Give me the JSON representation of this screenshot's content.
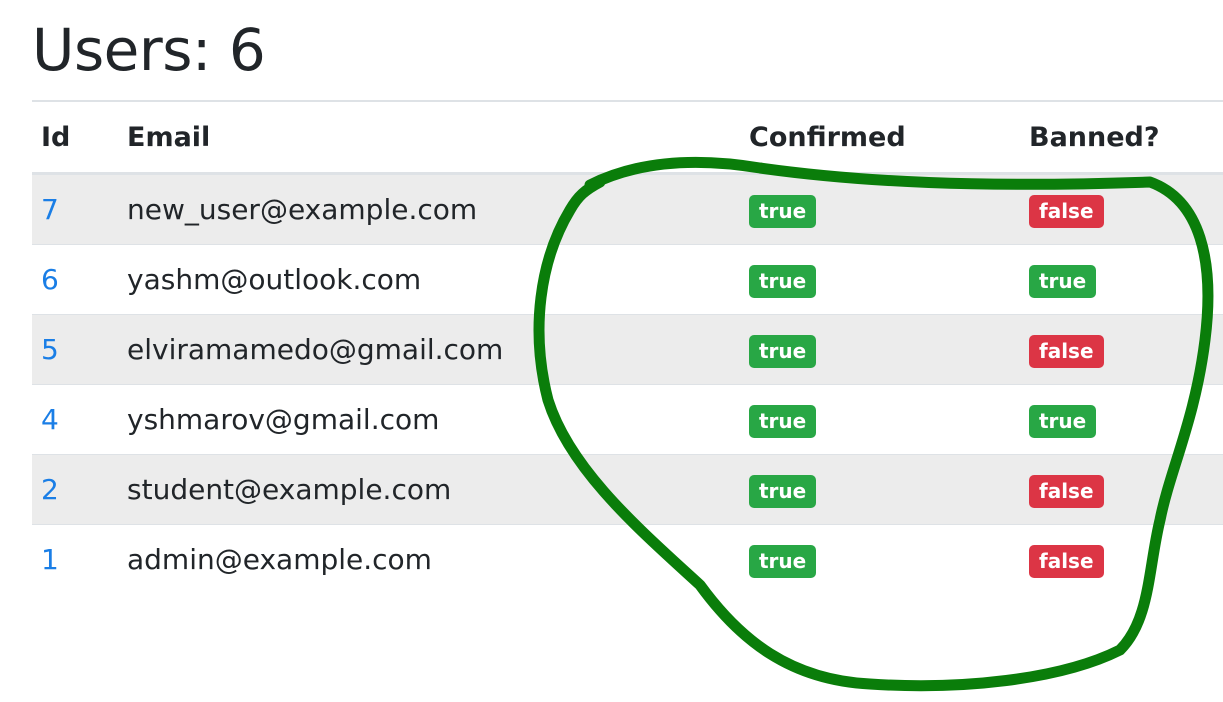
{
  "page": {
    "title": "Users: 6"
  },
  "table": {
    "headers": {
      "id": "Id",
      "email": "Email",
      "confirmed": "Confirmed",
      "banned": "Banned?"
    },
    "rows": [
      {
        "id": "7",
        "email": "new_user@example.com",
        "confirmed": "true",
        "banned": "false"
      },
      {
        "id": "6",
        "email": "yashm@outlook.com",
        "confirmed": "true",
        "banned": "true"
      },
      {
        "id": "5",
        "email": "elviramamedo@gmail.com",
        "confirmed": "true",
        "banned": "false"
      },
      {
        "id": "4",
        "email": "yshmarov@gmail.com",
        "confirmed": "true",
        "banned": "true"
      },
      {
        "id": "2",
        "email": "student@example.com",
        "confirmed": "true",
        "banned": "false"
      },
      {
        "id": "1",
        "email": "admin@example.com",
        "confirmed": "true",
        "banned": "false"
      }
    ]
  },
  "colors": {
    "link": "#1a7ee6",
    "badge_true": "#28a745",
    "badge_false": "#dc3545",
    "annotation": "#0a7d0a"
  }
}
